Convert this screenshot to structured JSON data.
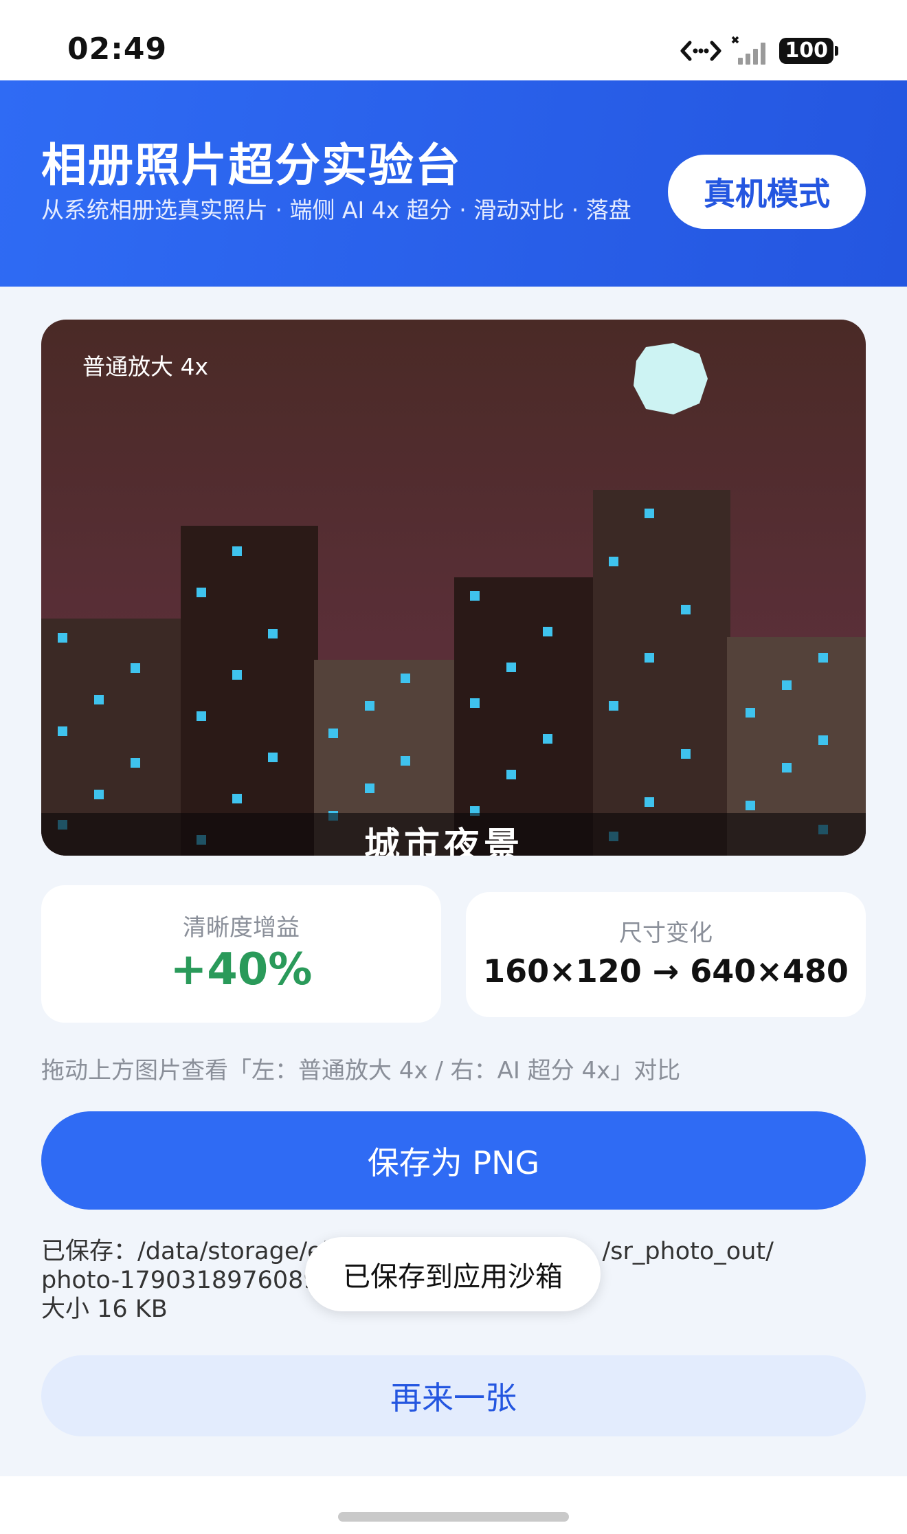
{
  "status_bar": {
    "time": "02:49",
    "battery": "100",
    "icons": [
      "data-transfer-icon",
      "signal-bars-icon",
      "battery-icon"
    ]
  },
  "header": {
    "title": "相册照片超分实验台",
    "subtitle": "从系统相册选真实照片 · 端侧 AI 4x 超分 · 滑动对比 · 落盘",
    "mode_button": "真机模式",
    "gradient": [
      "#2f6bf4",
      "#2456e0"
    ]
  },
  "image_view": {
    "overlay_label": "普通放大 4x",
    "caption": "城市夜景"
  },
  "stats": {
    "clarity_label": "清晰度增益",
    "clarity_value": "+40%",
    "size_label": "尺寸变化",
    "size_value": "160×120 → 640×480"
  },
  "hint": "拖动上方图片查看「左：普通放大 4x / 右：AI 超分 4x」对比",
  "save_button": "保存为 PNG",
  "saved_info": {
    "path_line_1": "已保存：/data/storage/el",
    "path_line_1_tail": "/sr_photo_out/",
    "path_line_2": "photo-1790318976089.",
    "size_line": "大小 16 KB"
  },
  "toast": "已保存到应用沙箱",
  "again_button": "再来一张",
  "colors": {
    "accent": "#2f6bf4",
    "success": "#2a9a5a",
    "window_light": "#3fc3ee"
  }
}
